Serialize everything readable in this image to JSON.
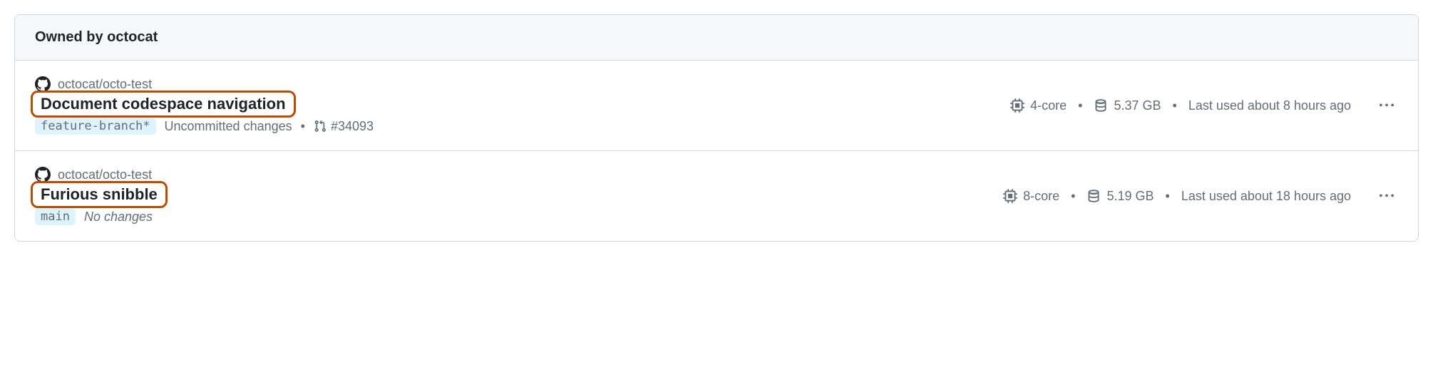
{
  "header": {
    "title": "Owned by octocat"
  },
  "codespaces": [
    {
      "repo": "octocat/octo-test",
      "title": "Document codespace navigation",
      "branch": "feature-branch*",
      "changes": "Uncommitted changes",
      "changes_italic": false,
      "pr": "#34093",
      "machine": "4-core",
      "storage": "5.37 GB",
      "last_used": "Last used about 8 hours ago"
    },
    {
      "repo": "octocat/octo-test",
      "title": "Furious snibble",
      "branch": "main",
      "changes": "No changes",
      "changes_italic": true,
      "pr": null,
      "machine": "8-core",
      "storage": "5.19 GB",
      "last_used": "Last used about 18 hours ago"
    }
  ]
}
